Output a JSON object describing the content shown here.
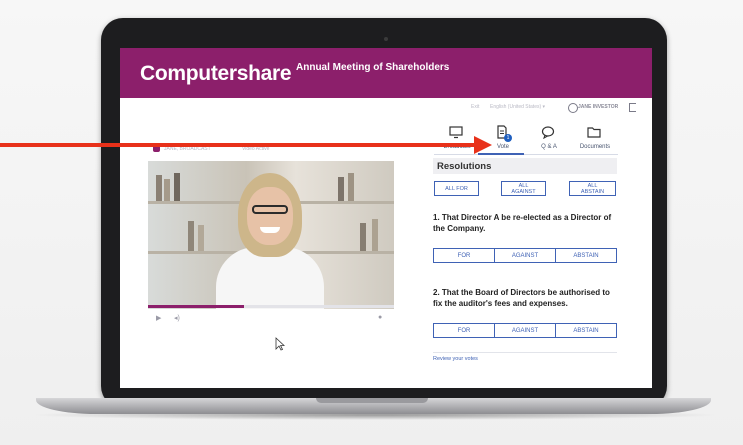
{
  "header": {
    "logo_text": "Computershare",
    "meeting_title": "Annual Meeting of Shareholders"
  },
  "topbar": {
    "exit_label": "Exit",
    "language_label": "English (United States) ▾",
    "user_label": "JANE INVESTOR"
  },
  "presenter": {
    "name": "JANE, BROADCAST",
    "status": "Video Active"
  },
  "video": {
    "progress_fraction": 0.39
  },
  "tabs": [
    {
      "label": "Broadcast",
      "icon": "monitor-icon"
    },
    {
      "label": "Vote",
      "icon": "document-icon",
      "badge": "1"
    },
    {
      "label": "Q & A",
      "icon": "chat-bubble-icon"
    },
    {
      "label": "Documents",
      "icon": "folder-icon"
    }
  ],
  "active_tab": "Vote",
  "resolutions": {
    "title": "Resolutions",
    "bulk_buttons": {
      "all_for": "ALL FOR",
      "all_against_1": "ALL",
      "all_against_2": "AGAINST",
      "all_abstain_1": "ALL",
      "all_abstain_2": "ABSTAIN"
    },
    "items": [
      {
        "question_line1": "1. That Director A be re-elected as a Director of",
        "question_line2": "the Company.",
        "for": "FOR",
        "against": "AGAINST",
        "abstain": "ABSTAIN"
      },
      {
        "question_line1": "2. That the Board of Directors be authorised to",
        "question_line2": "fix the auditor's fees and expenses.",
        "for": "FOR",
        "against": "AGAINST",
        "abstain": "ABSTAIN"
      }
    ],
    "review_link": "Review your votes"
  },
  "colors": {
    "brand": "#8c1f6b",
    "accent": "#3f62b5",
    "arrow": "#e8311a"
  }
}
